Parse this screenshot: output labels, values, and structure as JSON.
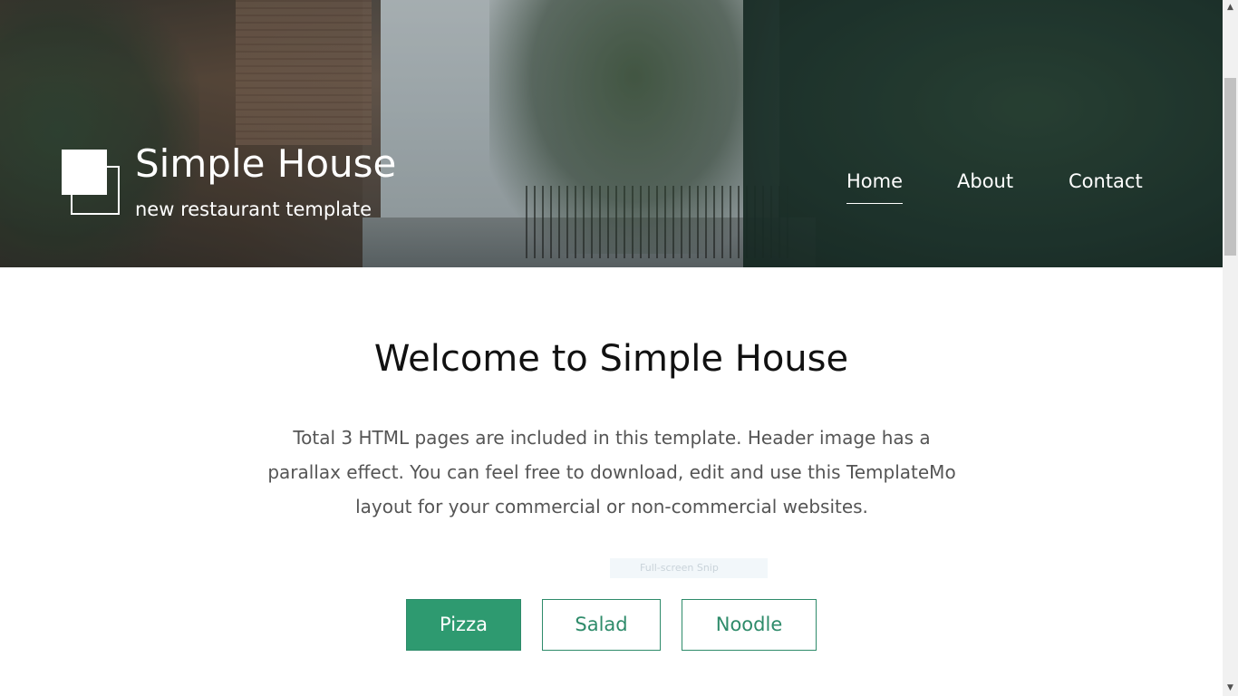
{
  "header": {
    "brand_title": "Simple House",
    "brand_tagline": "new restaurant template",
    "nav": [
      {
        "label": "Home",
        "active": true
      },
      {
        "label": "About",
        "active": false
      },
      {
        "label": "Contact",
        "active": false
      }
    ]
  },
  "main": {
    "welcome_title": "Welcome to Simple House",
    "intro_text": "Total 3 HTML pages are included in this template. Header image has a parallax effect. You can feel free to download, edit and use this TemplateMo layout for your commercial or non-commercial websites.",
    "tabs": [
      {
        "label": "Pizza",
        "active": true
      },
      {
        "label": "Salad",
        "active": false
      },
      {
        "label": "Noodle",
        "active": false
      }
    ]
  },
  "overlay": {
    "snip_tooltip": "Full-screen Snip"
  },
  "scrollbar": {
    "up_icon": "arrow-up-icon",
    "down_icon": "arrow-down-icon"
  },
  "colors": {
    "accent": "#2e9a70",
    "accent_border": "#2e8b6a",
    "text_dark": "#111111",
    "text_body": "#555555"
  }
}
